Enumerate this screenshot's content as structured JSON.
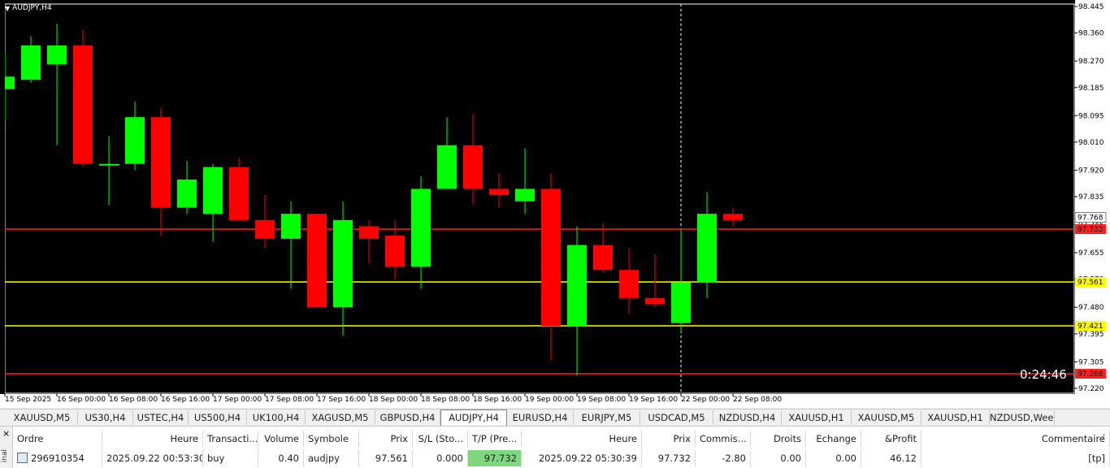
{
  "chart": {
    "symbol_label": "AUDJPY,H4",
    "timer": "0:24:46",
    "price_ticks": [
      "98.445",
      "98.360",
      "98.270",
      "98.185",
      "98.095",
      "98.010",
      "97.920",
      "97.835",
      "97.745",
      "97.655",
      "97.570",
      "97.480",
      "97.395",
      "97.305",
      "97.220"
    ],
    "time_labels": [
      "15 Sep 2025",
      "16 Sep 00:00",
      "16 Sep 08:00",
      "16 Sep 16:00",
      "17 Sep 00:00",
      "17 Sep 08:00",
      "17 Sep 16:00",
      "18 Sep 00:00",
      "18 Sep 08:00",
      "18 Sep 16:00",
      "19 Sep 00:00",
      "19 Sep 08:00",
      "19 Sep 16:00",
      "22 Sep 00:00",
      "22 Sep 08:00"
    ],
    "bid_price": "97.768",
    "hlines": [
      {
        "price": 97.732,
        "label": "97.732",
        "color": "#ff1f1f"
      },
      {
        "price": 97.561,
        "label": "97.561",
        "color": "#ffff00"
      },
      {
        "price": 97.421,
        "label": "97.421",
        "color": "#ffff00"
      },
      {
        "price": 97.268,
        "label": "97.268",
        "color": "#ff1f1f"
      }
    ],
    "colors": {
      "bull": "#00ff00",
      "bear": "#ff0000",
      "bg": "#000000",
      "axis_text": "#000000"
    }
  },
  "chart_data": {
    "type": "candlestick",
    "ylim": [
      97.22,
      98.46
    ],
    "candles": [
      {
        "o": 98.18,
        "h": 98.3,
        "l": 98.08,
        "c": 98.22
      },
      {
        "o": 98.21,
        "h": 98.35,
        "l": 98.2,
        "c": 98.32
      },
      {
        "o": 98.26,
        "h": 98.39,
        "l": 98.0,
        "c": 98.32
      },
      {
        "o": 98.32,
        "h": 98.37,
        "l": 97.93,
        "c": 97.94
      },
      {
        "o": 97.94,
        "h": 98.03,
        "l": 97.81,
        "c": 97.94
      },
      {
        "o": 97.94,
        "h": 98.14,
        "l": 97.92,
        "c": 98.09
      },
      {
        "o": 98.09,
        "h": 98.12,
        "l": 97.71,
        "c": 97.8
      },
      {
        "o": 97.8,
        "h": 97.95,
        "l": 97.78,
        "c": 97.89
      },
      {
        "o": 97.78,
        "h": 97.94,
        "l": 97.69,
        "c": 97.93
      },
      {
        "o": 97.93,
        "h": 97.96,
        "l": 97.76,
        "c": 97.76
      },
      {
        "o": 97.76,
        "h": 97.84,
        "l": 97.67,
        "c": 97.7
      },
      {
        "o": 97.7,
        "h": 97.82,
        "l": 97.54,
        "c": 97.78
      },
      {
        "o": 97.78,
        "h": 97.78,
        "l": 97.48,
        "c": 97.48
      },
      {
        "o": 97.48,
        "h": 97.82,
        "l": 97.39,
        "c": 97.76
      },
      {
        "o": 97.74,
        "h": 97.76,
        "l": 97.62,
        "c": 97.7
      },
      {
        "o": 97.71,
        "h": 97.76,
        "l": 97.57,
        "c": 97.61
      },
      {
        "o": 97.61,
        "h": 97.9,
        "l": 97.54,
        "c": 97.86
      },
      {
        "o": 97.86,
        "h": 98.09,
        "l": 97.86,
        "c": 98.0
      },
      {
        "o": 98.0,
        "h": 98.1,
        "l": 97.81,
        "c": 97.86
      },
      {
        "o": 97.86,
        "h": 97.91,
        "l": 97.8,
        "c": 97.84
      },
      {
        "o": 97.82,
        "h": 97.99,
        "l": 97.78,
        "c": 97.86
      },
      {
        "o": 97.86,
        "h": 97.91,
        "l": 97.31,
        "c": 97.42
      },
      {
        "o": 97.42,
        "h": 97.74,
        "l": 97.26,
        "c": 97.68
      },
      {
        "o": 97.68,
        "h": 97.75,
        "l": 97.59,
        "c": 97.6
      },
      {
        "o": 97.6,
        "h": 97.67,
        "l": 97.46,
        "c": 97.51
      },
      {
        "o": 97.51,
        "h": 97.65,
        "l": 97.48,
        "c": 97.49
      },
      {
        "o": 97.43,
        "h": 97.73,
        "l": 97.4,
        "c": 97.56
      },
      {
        "o": 97.56,
        "h": 97.85,
        "l": 97.51,
        "c": 97.78
      },
      {
        "o": 97.78,
        "h": 97.8,
        "l": 97.74,
        "c": 97.76
      }
    ]
  },
  "tabs": [
    "XAUUSD,M5",
    "US30,H4",
    "USTEC,H4",
    "US500,H4",
    "UK100,H4",
    "XAGUSD,M5",
    "GBPUSD,H4",
    "AUDJPY,H4",
    "EURUSD,H4",
    "EURJPY,M5",
    "USDCAD,M5",
    "NZDUSD,H4",
    "XAUUSD,H1",
    "XAUUSD,M5",
    "XAUUSD,H1",
    "NZDUSD,Weekly"
  ],
  "active_tab": "AUDJPY,H4",
  "terminal": {
    "side_label": "inal",
    "close_glyph": "×",
    "headers": [
      "Ordre",
      "Heure",
      "Transacti...",
      "Volume",
      "Symbole",
      "Prix",
      "S/L (Sto...",
      "T/P (Pre...",
      "Heure",
      "Prix",
      "Commis...",
      "Droits",
      "Echange",
      "&Profit",
      "Commentaire"
    ],
    "sort_glyph": "/",
    "row": [
      "296910354",
      "2025.09.22 00:53:30",
      "buy",
      "0.40",
      "audjpy",
      "97.561",
      "0.000",
      "97.732",
      "2025.09.22 05:30:39",
      "97.732",
      "-2.80",
      "0.00",
      "0.00",
      "46.12",
      "[tp]"
    ]
  }
}
